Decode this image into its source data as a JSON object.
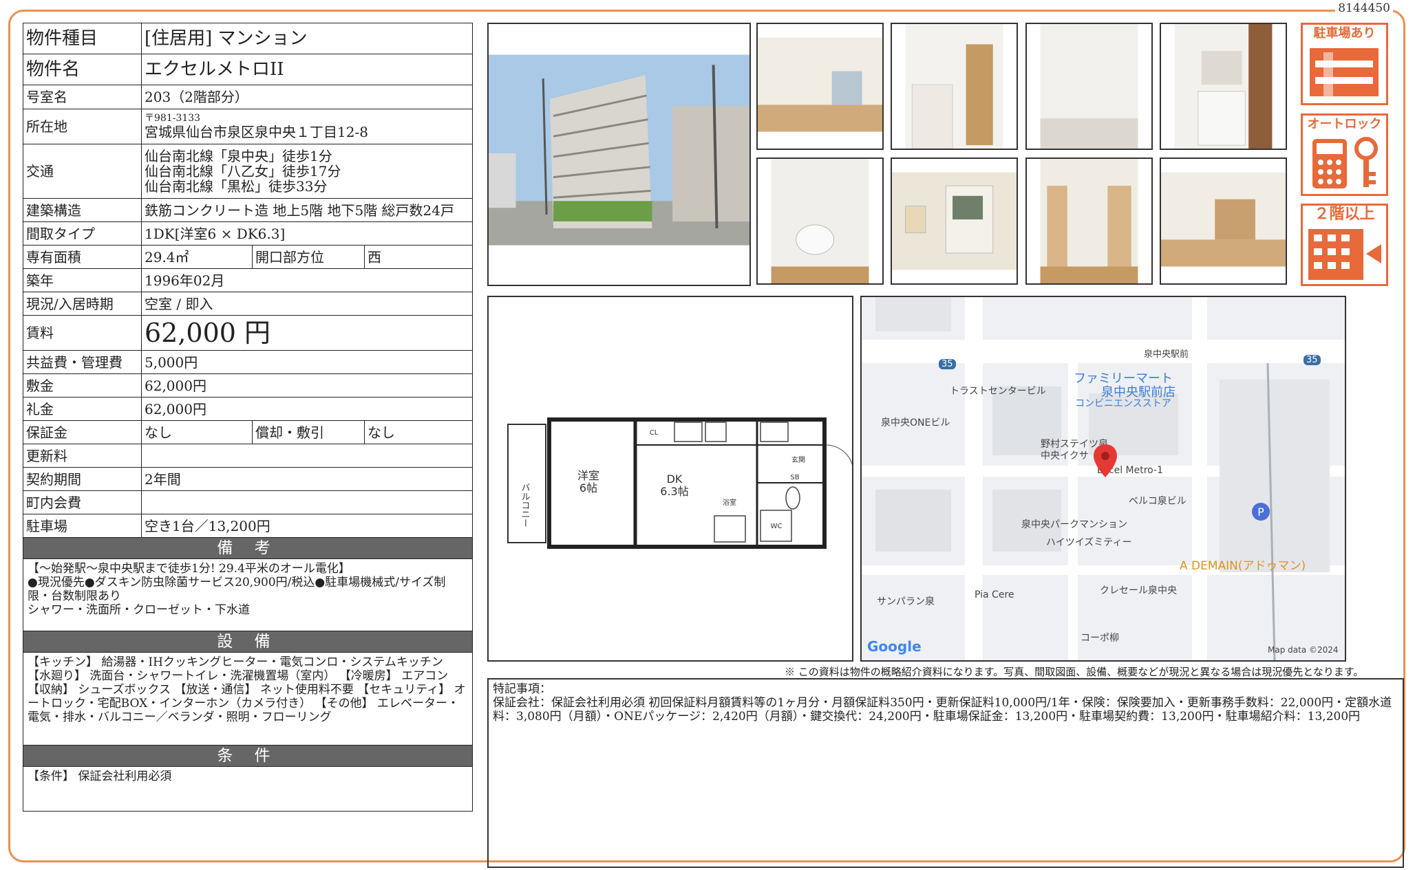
{
  "doc_number": "8144450",
  "property": {
    "rows": [
      {
        "label": "物件種目",
        "value": "[住居用] マンション"
      },
      {
        "label": "物件名",
        "value": "エクセルメトロII"
      },
      {
        "label": "号室名",
        "value": "203（2階部分）"
      },
      {
        "label": "所在地",
        "postal": "〒981-3133",
        "value": "宮城県仙台市泉区泉中央１丁目12-8"
      },
      {
        "label": "交通",
        "lines": [
          "仙台南北線「泉中央」徒歩1分",
          "仙台南北線「八乙女」徒歩17分",
          "仙台南北線「黒松」徒歩33分"
        ]
      },
      {
        "label": "建築構造",
        "value": "鉄筋コンクリート造 地上5階 地下5階 総戸数24戸"
      },
      {
        "label": "間取タイプ",
        "value": "1DK[洋室6 × DK6.3]"
      },
      {
        "label": "専有面積",
        "value": "29.4㎡",
        "label2": "開口部方位",
        "value2": "西"
      },
      {
        "label": "築年",
        "value": "1996年02月"
      },
      {
        "label": "現況/入居時期",
        "value": "空室 / 即入"
      },
      {
        "label": "賃料",
        "value": "62,000 円"
      },
      {
        "label": "共益費・管理費",
        "value": "5,000円"
      },
      {
        "label": "敷金",
        "value": "62,000円"
      },
      {
        "label": "礼金",
        "value": "62,000円"
      },
      {
        "label": "保証金",
        "value": "なし",
        "label2": "償却・敷引",
        "value2": "なし"
      },
      {
        "label": "更新料",
        "value": ""
      },
      {
        "label": "契約期間",
        "value": "2年間"
      },
      {
        "label": "町内会費",
        "value": ""
      },
      {
        "label": "駐車場",
        "value": "空き1台／13,200円"
      }
    ]
  },
  "remarks": {
    "title": "備 考",
    "text": "【～始発駅～泉中央駅まで徒歩1分! 29.4平米のオール電化】\n●現況優先●ダスキン防虫除菌サービス20,900円/税込●駐車場機械式/サイズ制限・台数制限あり\nシャワー・洗面所・クローゼット・下水道"
  },
  "equipment": {
    "title": "設 備",
    "text": "【キッチン】 給湯器・IHクッキングヒーター・電気コンロ・システムキッチン 【水廻り】 洗面台・シャワートイレ・洗濯機置場（室内） 【冷暖房】 エアコン 【収納】 シューズボックス 【放送・通信】 ネット使用料不要 【セキュリティ】 オートロック・宅配BOX・インターホン（カメラ付き） 【その他】 エレベーター・電気・排水・バルコニー／ベランダ・照明・フローリング"
  },
  "conditions": {
    "title": "条 件",
    "text": "【条件】 保証会社利用必須"
  },
  "badges": [
    "駐車場あり",
    "オートロック",
    "２階以上"
  ],
  "floorplan": {
    "balcony": "バルコニー",
    "room1": "洋室",
    "room1_size": "6帖",
    "room2": "DK",
    "room2_size": "6.3帖",
    "cl": "CL",
    "bath": "浴室",
    "sb": "SB",
    "entrance": "玄関",
    "wc": "WC"
  },
  "map": {
    "labels": [
      "泉中央駅前",
      "ファミリーマート",
      "泉中央駅前店",
      "コンビニエンスストア",
      "トラストセンタービル",
      "泉中央ONEビル",
      "野村ステイツ泉",
      "中央イクサ",
      "Excel Metro-1",
      "ベルコ泉ビル",
      "泉中央パークマンション",
      "ハイツイズミティー",
      "A DEMAIN(アドゥマン)",
      "サンパラン泉",
      "Pia Cere",
      "クレセール泉中央",
      "コーポ柳",
      "35",
      "35",
      "Google",
      "Map data ©2024"
    ]
  },
  "disclaimer": "※ この資料は物件の概略紹介資料になります。写真、間取図面、設備、概要などが現況と異なる場合は現況優先となります。",
  "notes": {
    "title": "特記事項：",
    "text": "保証会社：保証会社利用必須 初回保証料月額賃料等の1ヶ月分・月額保証料350円・更新保証料10,000円/1年・保険：保険要加入・更新事務手数料：22,000円・定額水道料：3,080円（月額）・ONEパッケージ：2,420円（月額）・鍵交換代：24,200円・駐車場保証金：13,200円・駐車場契約費：13,200円・駐車場紹介料：13,200円"
  },
  "colors": {
    "accent": "#e8693a",
    "frame": "#e8914f",
    "section_bg": "#666666"
  }
}
